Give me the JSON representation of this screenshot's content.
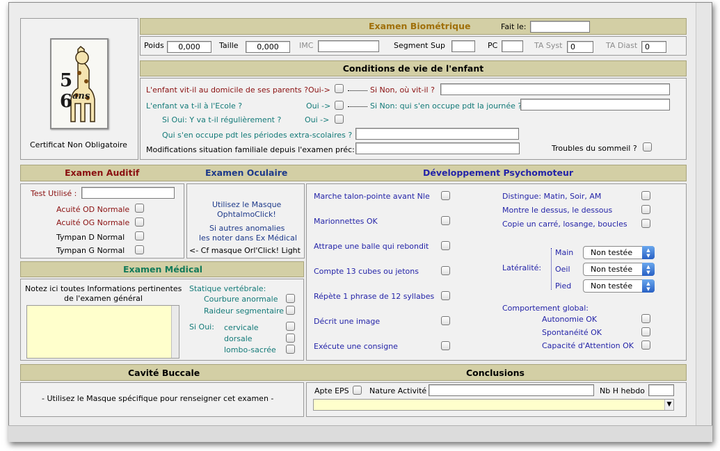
{
  "biometrie": {
    "title": "Examen Biométrique",
    "fait_le": "Fait le:",
    "fait_le_value": "",
    "poids": "Poids",
    "poids_value": "0,000",
    "taille": "Taille",
    "taille_value": "0,000",
    "imc": "IMC",
    "imc_value": "",
    "segment_sup": "Segment Sup",
    "segment_value": "",
    "pc": "PC",
    "pc_value": "",
    "ta_syst": "TA Syst",
    "ta_syst_value": "0",
    "ta_diast": "TA Diast",
    "ta_diast_value": "0"
  },
  "logo": {
    "caption": "Certificat Non Obligatoire",
    "digits": "5 6",
    "ans": "ans"
  },
  "conditions": {
    "title": "Conditions de vie de l'enfant",
    "q1": "L'enfant vit-il au domicile de ses parents ?",
    "q1_oui": "Oui->",
    "q1_sinon": "Si Non, où vit-il ?",
    "q1_value": "",
    "q2": "L'enfant va t-il à l'Ecole ?",
    "q2_oui": "Oui ->",
    "q2_sinon": "Si Non: qui s'en occupe pdt la journée ?",
    "q2_value": "",
    "q3": "Si Oui: Y va t-il régulièrement ?",
    "q3_oui": "Oui ->",
    "q4": "Qui s'en occupe pdt les périodes extra-scolaires ?",
    "q4_value": "",
    "q5": "Modifications situation familiale depuis l'examen préc:",
    "q5_value": "",
    "sommeil": "Troubles du sommeil ?"
  },
  "auditif": {
    "title": "Examen Auditif",
    "test": "Test Utilisé :",
    "test_value": "",
    "od": "Acuité OD Normale",
    "og": "Acuité OG Normale",
    "td": "Tympan D Normal",
    "tg": "Tympan G Normal"
  },
  "oculaire": {
    "title": "Examen Oculaire",
    "l1": "Utilisez le Masque",
    "l2": "OphtalmoClick!",
    "l3": "Si autres anomalies",
    "l4": "les noter dans Ex Médical",
    "l5": "<- Cf masque Orl'Click! Light"
  },
  "psycho": {
    "title": "Développement Psychomoteur",
    "left": [
      "Marche talon-pointe avant Nle",
      "Marionnettes OK",
      "Attrape une balle qui rebondit",
      "Compte 13 cubes ou jetons",
      "Répète 1 phrase de 12 syllabes",
      "Décrit une image",
      "Exécute une consigne"
    ],
    "right": [
      "Distingue: Matin, Soir, AM",
      "Montre le dessus, le dessous",
      "Copie un carré, losange, boucles"
    ],
    "lateralite": "Latéralité:",
    "lat_items": [
      "Main",
      "Oeil",
      "Pied"
    ],
    "lat_value": "Non testée",
    "comportement": "Comportement global:",
    "comp_items": [
      "Autonomie OK",
      "Spontanéité OK",
      "Capacité d'Attention OK"
    ]
  },
  "medical": {
    "title": "Examen Médical",
    "note1": "Notez ici toutes Informations pertinentes",
    "note2": "de l'examen général",
    "notes_value": "",
    "statique": "Statique vertébrale:",
    "courbure": "Courbure anormale",
    "raideur": "Raideur segmentaire",
    "si_oui": "Si Oui:",
    "cervicale": "cervicale",
    "dorsale": "dorsale",
    "lombo": "lombo-sacrée"
  },
  "buccale": {
    "title": "Cavité Buccale",
    "note": "- Utilisez le Masque spécifique pour renseigner cet examen -"
  },
  "conclusions": {
    "title": "Conclusions",
    "apte": "Apte EPS",
    "nature": "Nature Activité",
    "nature_value": "",
    "nbh": "Nb H hebdo",
    "nbh_value": "",
    "text_value": ""
  },
  "colors": {
    "header_bg": "#d3cfa5",
    "title_orange": "#a0700a",
    "title_red": "#8a1010",
    "title_blue": "#2424a8",
    "title_teal": "#137a78"
  }
}
